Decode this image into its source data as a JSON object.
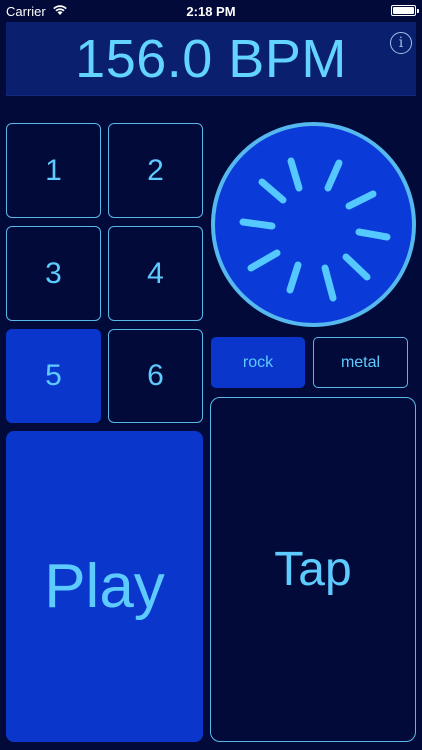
{
  "status_bar": {
    "carrier": "Carrier",
    "time": "2:18 PM"
  },
  "display": {
    "bpm": "156.0 BPM",
    "info_icon": "info-icon"
  },
  "pads": [
    "1",
    "2",
    "3",
    "4",
    "5",
    "6"
  ],
  "active_pad": "5",
  "styles": {
    "rock": "rock",
    "metal": "metal",
    "selected": "rock"
  },
  "controls": {
    "play": "Play",
    "tap": "Tap"
  },
  "colors": {
    "background": "#020a3a",
    "accent": "#0a36cc",
    "text": "#5ecbff",
    "border": "#5ab8e6"
  }
}
